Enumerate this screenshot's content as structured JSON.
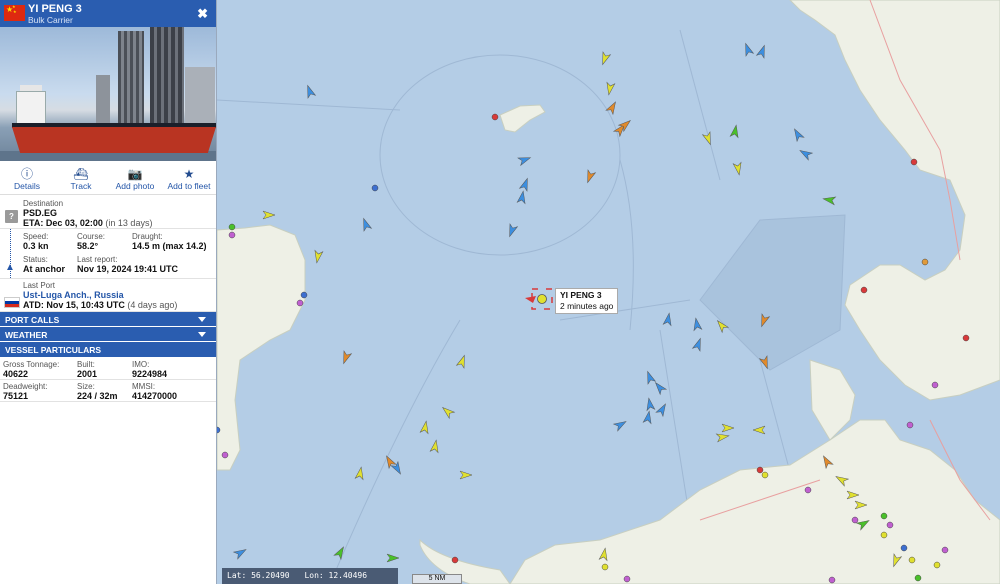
{
  "vessel": {
    "name": "YI PENG 3",
    "type": "Bulk Carrier",
    "flag": "china-flag"
  },
  "tools": [
    {
      "label": "Details",
      "icon": "info-icon"
    },
    {
      "label": "Track",
      "icon": "ship-icon"
    },
    {
      "label": "Add photo",
      "icon": "camera-icon"
    },
    {
      "label": "Add to fleet",
      "icon": "star-icon"
    }
  ],
  "destination": {
    "label": "Destination",
    "value": "PSD.EG",
    "eta_label": "ETA:",
    "eta": "Dec 03, 02:00",
    "eta_rel": "(in 13 days)"
  },
  "nav": {
    "speed_label": "Speed:",
    "speed": "0.3 kn",
    "course_label": "Course:",
    "course": "58.2°",
    "draught_label": "Draught:",
    "draught": "14.5 m (max 14.2)",
    "status_label": "Status:",
    "status": "At anchor",
    "report_label": "Last report:",
    "report": "Nov 19, 2024 19:41 UTC"
  },
  "last_port": {
    "label": "Last Port",
    "value": "Ust-Luga Anch., Russia",
    "atd_label": "ATD:",
    "atd": "Nov 15, 10:43 UTC",
    "atd_rel": "(4 days ago)"
  },
  "sections": [
    "PORT CALLS",
    "WEATHER",
    "VESSEL PARTICULARS"
  ],
  "particulars": {
    "gt_label": "Gross Tonnage:",
    "gt": "40622",
    "built_label": "Built:",
    "built": "2001",
    "imo_label": "IMO:",
    "imo": "9224984",
    "dwt_label": "Deadweight:",
    "dwt": "75121",
    "size_label": "Size:",
    "size": "224 / 32m",
    "mmsi_label": "MMSI:",
    "mmsi": "414270000"
  },
  "map_label": {
    "name": "YI PENG 3",
    "time": "2 minutes ago"
  },
  "coords": {
    "lat": "Lat: 56.20490",
    "lon": "Lon: 12.40496"
  },
  "scale": "5 NM",
  "colors": {
    "header": "#2a5db0",
    "sea": "#b4cde6",
    "land": "#eef0e6",
    "tanker": "#e08a2c",
    "cargo": "#e0e030",
    "passenger": "#3d8fe0",
    "fishing": "#4ac02a"
  }
}
